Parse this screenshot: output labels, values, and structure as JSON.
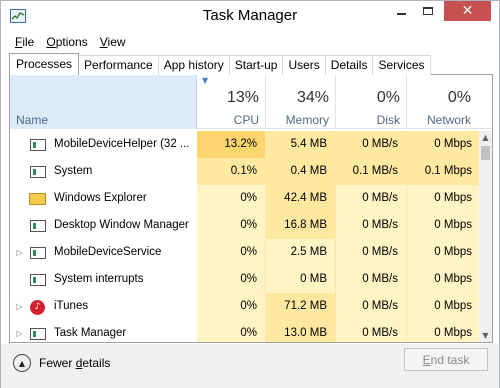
{
  "window": {
    "title": "Task Manager"
  },
  "menu": [
    {
      "pre": "",
      "u": "F",
      "post": "ile"
    },
    {
      "pre": "",
      "u": "O",
      "post": "ptions"
    },
    {
      "pre": "",
      "u": "V",
      "post": "iew"
    }
  ],
  "tabs": [
    "Processes",
    "Performance",
    "App history",
    "Start-up",
    "Users",
    "Details",
    "Services"
  ],
  "active_tab": "Processes",
  "columns": {
    "name": {
      "label": "Name"
    },
    "cpu": {
      "pct": "13%",
      "label": "CPU"
    },
    "memory": {
      "pct": "34%",
      "label": "Memory"
    },
    "disk": {
      "pct": "0%",
      "label": "Disk"
    },
    "network": {
      "pct": "0%",
      "label": "Network"
    }
  },
  "processes": [
    {
      "name": "MobileDeviceHelper (32 ...",
      "icon": "exe-icon",
      "expandable": false,
      "cpu": "13.2%",
      "memory": "5.4 MB",
      "disk": "0 MB/s",
      "network": "0 Mbps"
    },
    {
      "name": "System",
      "icon": "exe-icon",
      "expandable": false,
      "cpu": "0.1%",
      "memory": "0.4 MB",
      "disk": "0.1 MB/s",
      "network": "0.1 Mbps"
    },
    {
      "name": "Windows Explorer",
      "icon": "folder-icon",
      "expandable": false,
      "cpu": "0%",
      "memory": "42.4 MB",
      "disk": "0 MB/s",
      "network": "0 Mbps"
    },
    {
      "name": "Desktop Window Manager",
      "icon": "exe-icon",
      "expandable": false,
      "cpu": "0%",
      "memory": "16.8 MB",
      "disk": "0 MB/s",
      "network": "0 Mbps"
    },
    {
      "name": "MobileDeviceService",
      "icon": "exe-icon",
      "expandable": true,
      "cpu": "0%",
      "memory": "2.5 MB",
      "disk": "0 MB/s",
      "network": "0 Mbps"
    },
    {
      "name": "System interrupts",
      "icon": "exe-icon",
      "expandable": false,
      "cpu": "0%",
      "memory": "0 MB",
      "disk": "0 MB/s",
      "network": "0 Mbps"
    },
    {
      "name": "iTunes",
      "icon": "itunes-icon",
      "expandable": true,
      "cpu": "0%",
      "memory": "71.2 MB",
      "disk": "0 MB/s",
      "network": "0 Mbps"
    },
    {
      "name": "Task Manager",
      "icon": "exe-icon",
      "expandable": true,
      "cpu": "0%",
      "memory": "13.0 MB",
      "disk": "0 MB/s",
      "network": "0 Mbps"
    }
  ],
  "footer": {
    "fewer_pre": "Fewer ",
    "fewer_u": "d",
    "fewer_post": "etails",
    "end_pre": "",
    "end_u": "E",
    "end_post": "nd task"
  }
}
